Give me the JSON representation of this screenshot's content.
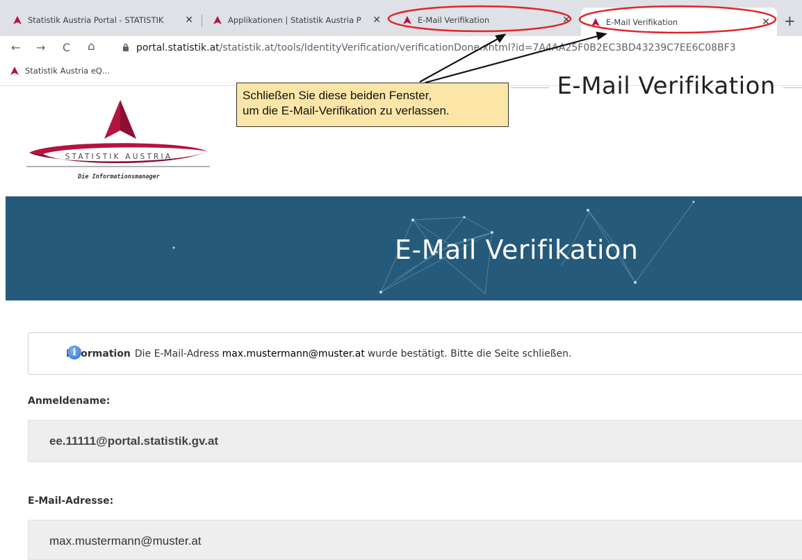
{
  "browser": {
    "tabs": [
      {
        "label": "Statistik Austria Portal - STATISTIK",
        "active": false
      },
      {
        "label": "Applikationen | Statistik Austria P",
        "active": false
      },
      {
        "label": "E-Mail Verifikation",
        "active": false
      },
      {
        "label": "E-Mail Verifikation",
        "active": true
      }
    ],
    "close_glyph": "✕",
    "new_tab_glyph": "+",
    "nav": {
      "back": "←",
      "forward": "→",
      "reload": "C",
      "home": "⌂"
    },
    "url_host": "portal.statistik.at",
    "url_path": "/statistik.at/tools/IdentityVerification/verificationDone.xhtml?id=7A4AA25F0B2EC3BD43239C7EE6C08BF3",
    "bookmark": "Statistik Austria eQ..."
  },
  "header": {
    "title": "E-Mail Verifikation"
  },
  "logo": {
    "brand": "STATISTIK AUSTRIA",
    "tagline": "Die Informationsmanager"
  },
  "callout": {
    "line1": "Schließen Sie diese beiden Fenster,",
    "line2": "um die E-Mail-Verifikation zu verlassen."
  },
  "banner": {
    "title": "E-Mail Verifikation"
  },
  "info": {
    "label": "Information",
    "text_before": "Die E-Mail-Adress",
    "email": "max.mustermann@muster.at",
    "text_after": "wurde bestätigt. Bitte die Seite schließen."
  },
  "fields": {
    "username_label": "Anmeldename:",
    "username_value": "ee.11111@portal.statistik.gv.at",
    "email_label": "E-Mail-Adresse:",
    "email_value": "max.mustermann@muster.at"
  },
  "colors": {
    "banner": "#255a7a",
    "callout": "#fbe6a7",
    "annotation": "#e0242b",
    "brand": "#b5133f"
  }
}
